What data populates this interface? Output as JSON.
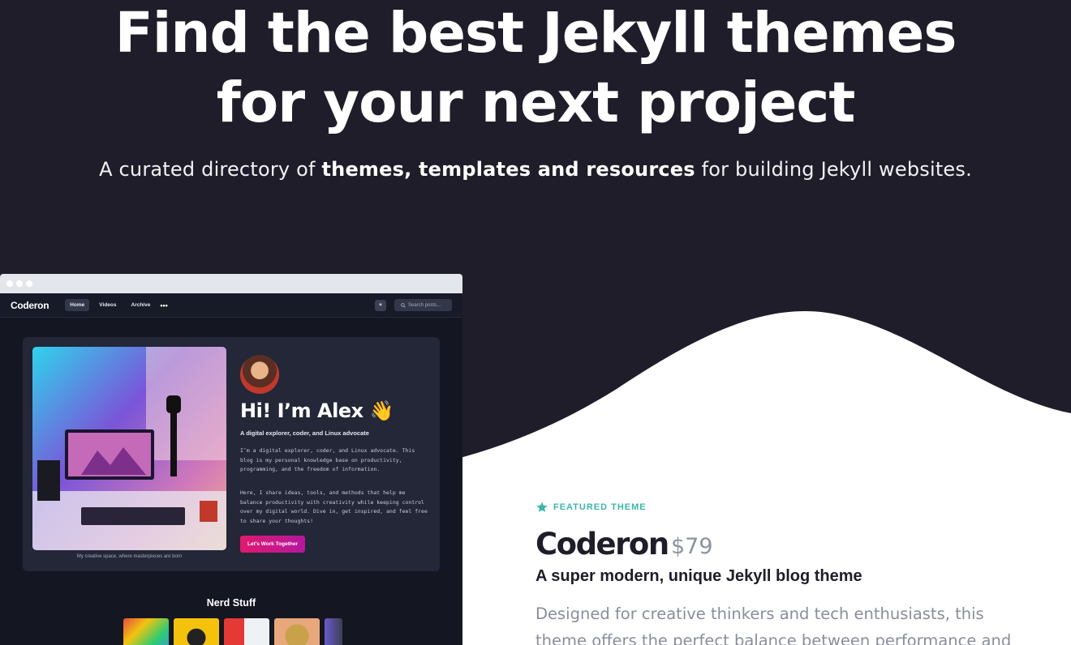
{
  "hero": {
    "title_line1": "Find the best Jekyll themes",
    "title_line2": "for your next project",
    "subtitle_pre": "A curated directory of ",
    "subtitle_bold": "themes, templates and resources",
    "subtitle_post": " for building Jekyll websites."
  },
  "mockup": {
    "logo": "Coderon",
    "nav": [
      "Home",
      "Videos",
      "Archive"
    ],
    "more": "•••",
    "search_placeholder": "Search posts...",
    "photo_caption": "My creative space, where masterpieces are born",
    "greeting": "Hi! I’m Alex 👋",
    "tagline": "A digital explorer, coder, and Linux advocate",
    "bio_1": "I’m a digital explorer, coder, and Linux advocate. This blog is my personal knowledge base on productivity, programming, and the freedom of information.",
    "bio_2": "Here, I share ideas, tools, and methods that help me balance productivity with creativity while keeping control over my digital world. Dive in, get inspired, and feel free to share your thoughts!",
    "cta": "Let’s Work Together",
    "section_title": "Nerd Stuff"
  },
  "featured": {
    "label": "FEATURED THEME",
    "name": "Coderon",
    "price": "$79",
    "tagline": "A super modern, unique Jekyll blog theme",
    "description": "Designed for creative thinkers and tech enthusiasts, this theme offers the perfect balance between performance and"
  },
  "colors": {
    "background": "#1f1d29",
    "accent_teal": "#3cb6a8",
    "cta_pink": "#e0196f"
  },
  "icons": {
    "featured": "star-icon",
    "search": "search-icon",
    "theme_toggle": "sun-icon"
  }
}
